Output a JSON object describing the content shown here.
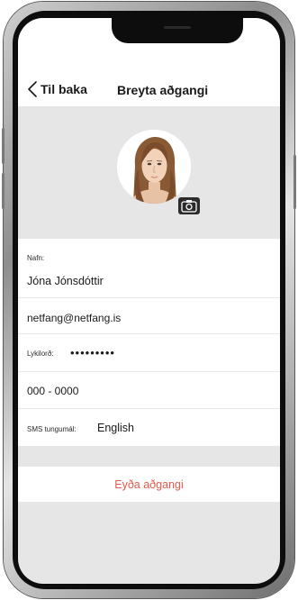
{
  "header": {
    "back_label": "Til baka",
    "title": "Breyta aðgangi"
  },
  "profile": {
    "avatar_icon": "user-portrait-icon",
    "camera_icon": "camera-icon"
  },
  "form": {
    "name_label": "Nafn:",
    "name_value": "Jóna Jónsdóttir",
    "email_value": "netfang@netfang.is",
    "password_label": "Lykilorð:",
    "password_value": "•••••••••",
    "phone_value": "000 - 0000",
    "sms_language_label": "SMS tungumál:",
    "sms_language_value": "English"
  },
  "actions": {
    "delete_label": "Eyða aðgangi"
  },
  "colors": {
    "background_gray": "#e6e6e6",
    "delete_red": "#e25b4e",
    "text_dark": "#1a1a1a"
  }
}
